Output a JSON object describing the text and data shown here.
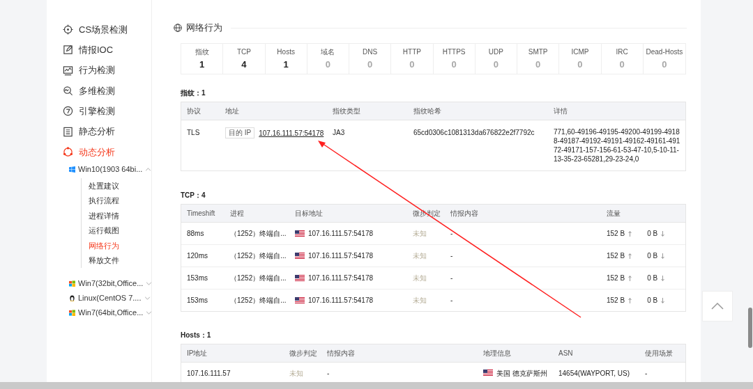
{
  "sidebar": {
    "items": [
      {
        "label": "CS场景检测",
        "selected": false
      },
      {
        "label": "情报IOC",
        "selected": false
      },
      {
        "label": "行为检测",
        "selected": false
      },
      {
        "label": "多维检测",
        "selected": false
      },
      {
        "label": "引擎检测",
        "selected": false
      },
      {
        "label": "静态分析",
        "selected": false
      },
      {
        "label": "动态分析",
        "selected": true,
        "children": [
          {
            "label": "Win10(1903 64bi...",
            "kind": "windows",
            "expanded": true,
            "children": [
              {
                "label": "处置建议",
                "selected": false
              },
              {
                "label": "执行流程",
                "selected": false
              },
              {
                "label": "进程详情",
                "selected": false
              },
              {
                "label": "运行截图",
                "selected": false
              },
              {
                "label": "网络行为",
                "selected": true
              },
              {
                "label": "释放文件",
                "selected": false
              }
            ]
          },
          {
            "label": "Win7(32bit,Office...",
            "kind": "windows-legacy",
            "expanded": false
          },
          {
            "label": "Linux(CentOS 7....",
            "kind": "linux",
            "expanded": false
          },
          {
            "label": "Win7(64bit,Office...",
            "kind": "windows-legacy",
            "expanded": false
          }
        ]
      }
    ]
  },
  "section": {
    "title": "网络行为",
    "stats": [
      {
        "label": "指纹",
        "value": "1",
        "dim": false
      },
      {
        "label": "TCP",
        "value": "4",
        "dim": false
      },
      {
        "label": "Hosts",
        "value": "1",
        "dim": false
      },
      {
        "label": "域名",
        "value": "0",
        "dim": true
      },
      {
        "label": "DNS",
        "value": "0",
        "dim": true
      },
      {
        "label": "HTTP",
        "value": "0",
        "dim": true
      },
      {
        "label": "HTTPS",
        "value": "0",
        "dim": true
      },
      {
        "label": "UDP",
        "value": "0",
        "dim": true
      },
      {
        "label": "SMTP",
        "value": "0",
        "dim": true
      },
      {
        "label": "ICMP",
        "value": "0",
        "dim": true
      },
      {
        "label": "IRC",
        "value": "0",
        "dim": true
      },
      {
        "label": "Dead-Hosts",
        "value": "0",
        "dim": true
      }
    ]
  },
  "fingerprint": {
    "title": "指纹：1",
    "columns": [
      "协议",
      "地址",
      "指纹类型",
      "指纹哈希",
      "详情"
    ],
    "rows": [
      {
        "protocol": "TLS",
        "address_tag": "目的 IP",
        "address": "107.16.111.57:54178",
        "type": "JA3",
        "hash": "65cd0306c1081313da676822e2f7792c",
        "details": "771,60-49196-49195-49200-49199-49188-49187-49192-49191-49162-49161-49172-49171-157-156-61-53-47-10,5-10-11-13-35-23-65281,29-23-24,0"
      }
    ]
  },
  "tcp": {
    "title": "TCP：4",
    "columns": [
      "Timeshift",
      "进程",
      "目标地址",
      "微步判定",
      "情报内容",
      "流量"
    ],
    "rows": [
      {
        "timeshift": "88ms",
        "process": "（1252）终端自...",
        "target": "107.16.111.57:54178",
        "verdict": "未知",
        "intel": "-",
        "up": "152 B",
        "down": "0 B"
      },
      {
        "timeshift": "120ms",
        "process": "（1252）终端自...",
        "target": "107.16.111.57:54178",
        "verdict": "未知",
        "intel": "-",
        "up": "152 B",
        "down": "0 B"
      },
      {
        "timeshift": "153ms",
        "process": "（1252）终端自...",
        "target": "107.16.111.57:54178",
        "verdict": "未知",
        "intel": "-",
        "up": "152 B",
        "down": "0 B"
      },
      {
        "timeshift": "153ms",
        "process": "（1252）终端自...",
        "target": "107.16.111.57:54178",
        "verdict": "未知",
        "intel": "-",
        "up": "152 B",
        "down": "0 B"
      }
    ]
  },
  "hosts": {
    "title": "Hosts：1",
    "columns": [
      "IP地址",
      "微步判定",
      "情报内容",
      "地理信息",
      "ASN",
      "使用场景"
    ],
    "rows": [
      {
        "ip": "107.16.111.57",
        "verdict": "未知",
        "intel": "-",
        "geo": "美国 德克萨斯州",
        "asn": "14654(WAYPORT, US)",
        "usage": "-"
      }
    ]
  }
}
